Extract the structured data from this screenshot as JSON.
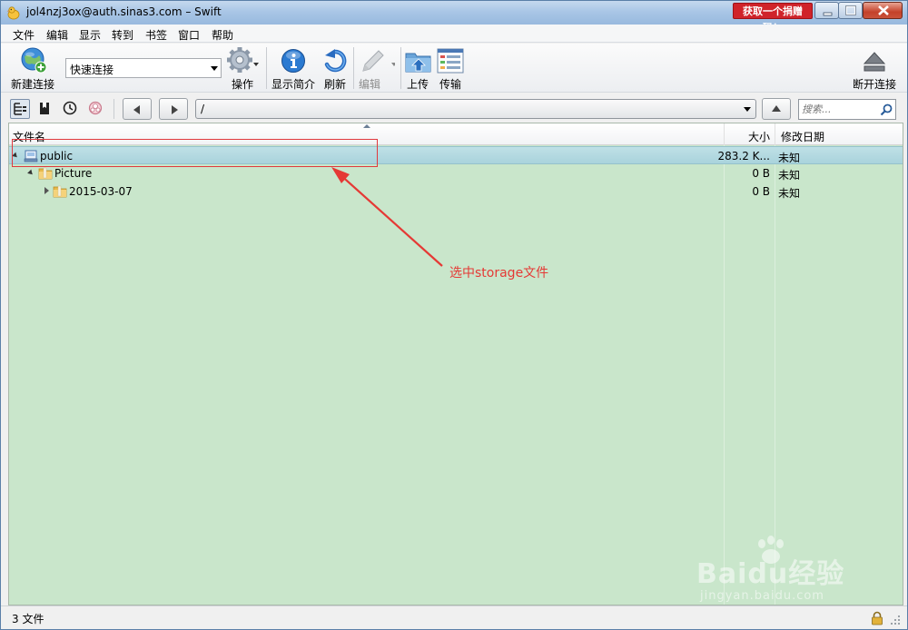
{
  "window": {
    "title": "jol4nzj3ox@auth.sinas3.com – Swift",
    "promo_label": "获取一个捐赠码！",
    "controls": [
      "minimize",
      "maximize",
      "close"
    ]
  },
  "menu": {
    "items": [
      "文件",
      "编辑",
      "显示",
      "转到",
      "书签",
      "窗口",
      "帮助"
    ]
  },
  "toolbar": {
    "new_connection": "新建连接",
    "quick_connect_value": "快速连接",
    "action": "操作",
    "info": "显示简介",
    "refresh": "刷新",
    "edit": "编辑",
    "upload": "上传",
    "transfers": "传输",
    "disconnect": "断开连接"
  },
  "navbar": {
    "path": "/",
    "search_placeholder": "搜索..."
  },
  "columns": {
    "name": "文件名",
    "size": "大小",
    "modified": "修改日期"
  },
  "files": [
    {
      "name": "public",
      "size": "283.2 K...",
      "modified": "未知",
      "type": "container",
      "expanded": true,
      "selected": true,
      "level": 0
    },
    {
      "name": "Picture",
      "size": "0 B",
      "modified": "未知",
      "type": "folder",
      "expanded": true,
      "selected": false,
      "level": 1
    },
    {
      "name": "2015-03-07",
      "size": "0 B",
      "modified": "未知",
      "type": "folder",
      "expanded": false,
      "selected": false,
      "level": 2
    }
  ],
  "annotation": {
    "text": "选中storage文件",
    "color": "#e53935"
  },
  "watermark": {
    "logo": "Baidu经验",
    "url": "jingyan.baidu.com"
  },
  "status": {
    "text": "3 文件"
  },
  "colors": {
    "list_bg": "#c9e6cb",
    "selected_row": "#a9d3dc",
    "promo": "#d0232a"
  }
}
